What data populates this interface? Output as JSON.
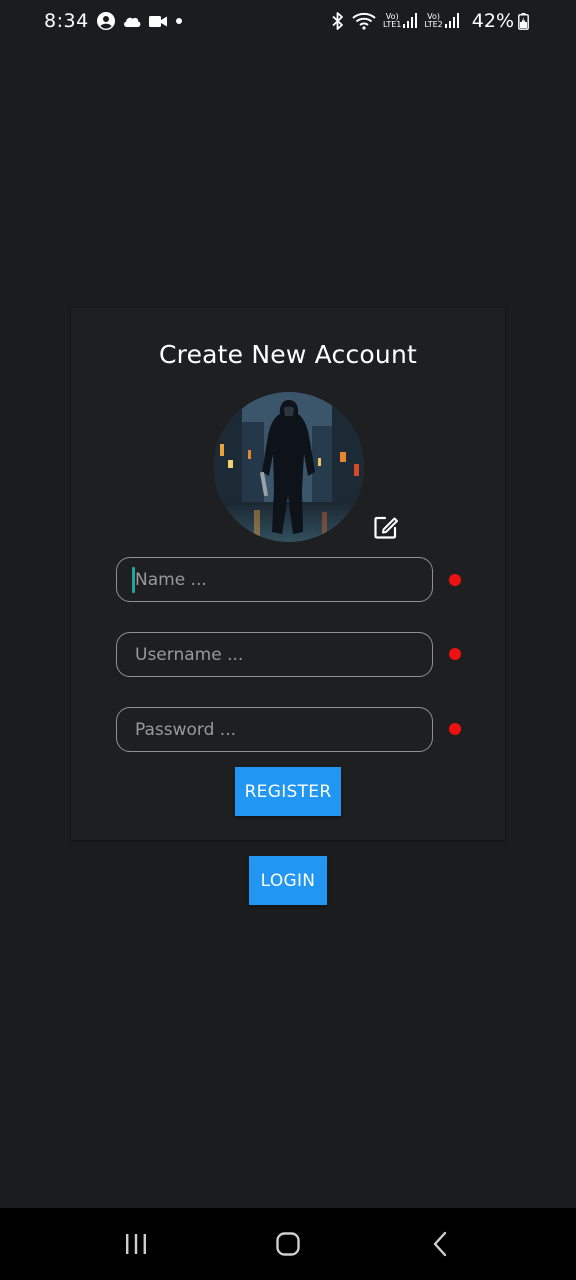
{
  "status_bar": {
    "time": "8:34",
    "battery": "42%",
    "lte1": [
      "Vo)",
      "LTE1"
    ],
    "lte2": [
      "Vo)",
      "LTE2"
    ],
    "icons": [
      "account-circle-icon",
      "cloud-icon",
      "video-camera-icon",
      "notification-dot-icon",
      "bluetooth-icon",
      "wifi-icon",
      "signal-icon",
      "battery-icon"
    ]
  },
  "form": {
    "title": "Create New Account",
    "name": {
      "value": "",
      "placeholder": "Name ..."
    },
    "username": {
      "value": "",
      "placeholder": "Username ..."
    },
    "password": {
      "value": "",
      "placeholder": "Password ..."
    },
    "register_label": "REGISTER"
  },
  "login_label": "LOGIN",
  "colors": {
    "background": "#1b1c1e",
    "card": "#1e1f21",
    "accent": "#2196f3",
    "required": "#ee1111",
    "cursor": "#1fa59a"
  }
}
